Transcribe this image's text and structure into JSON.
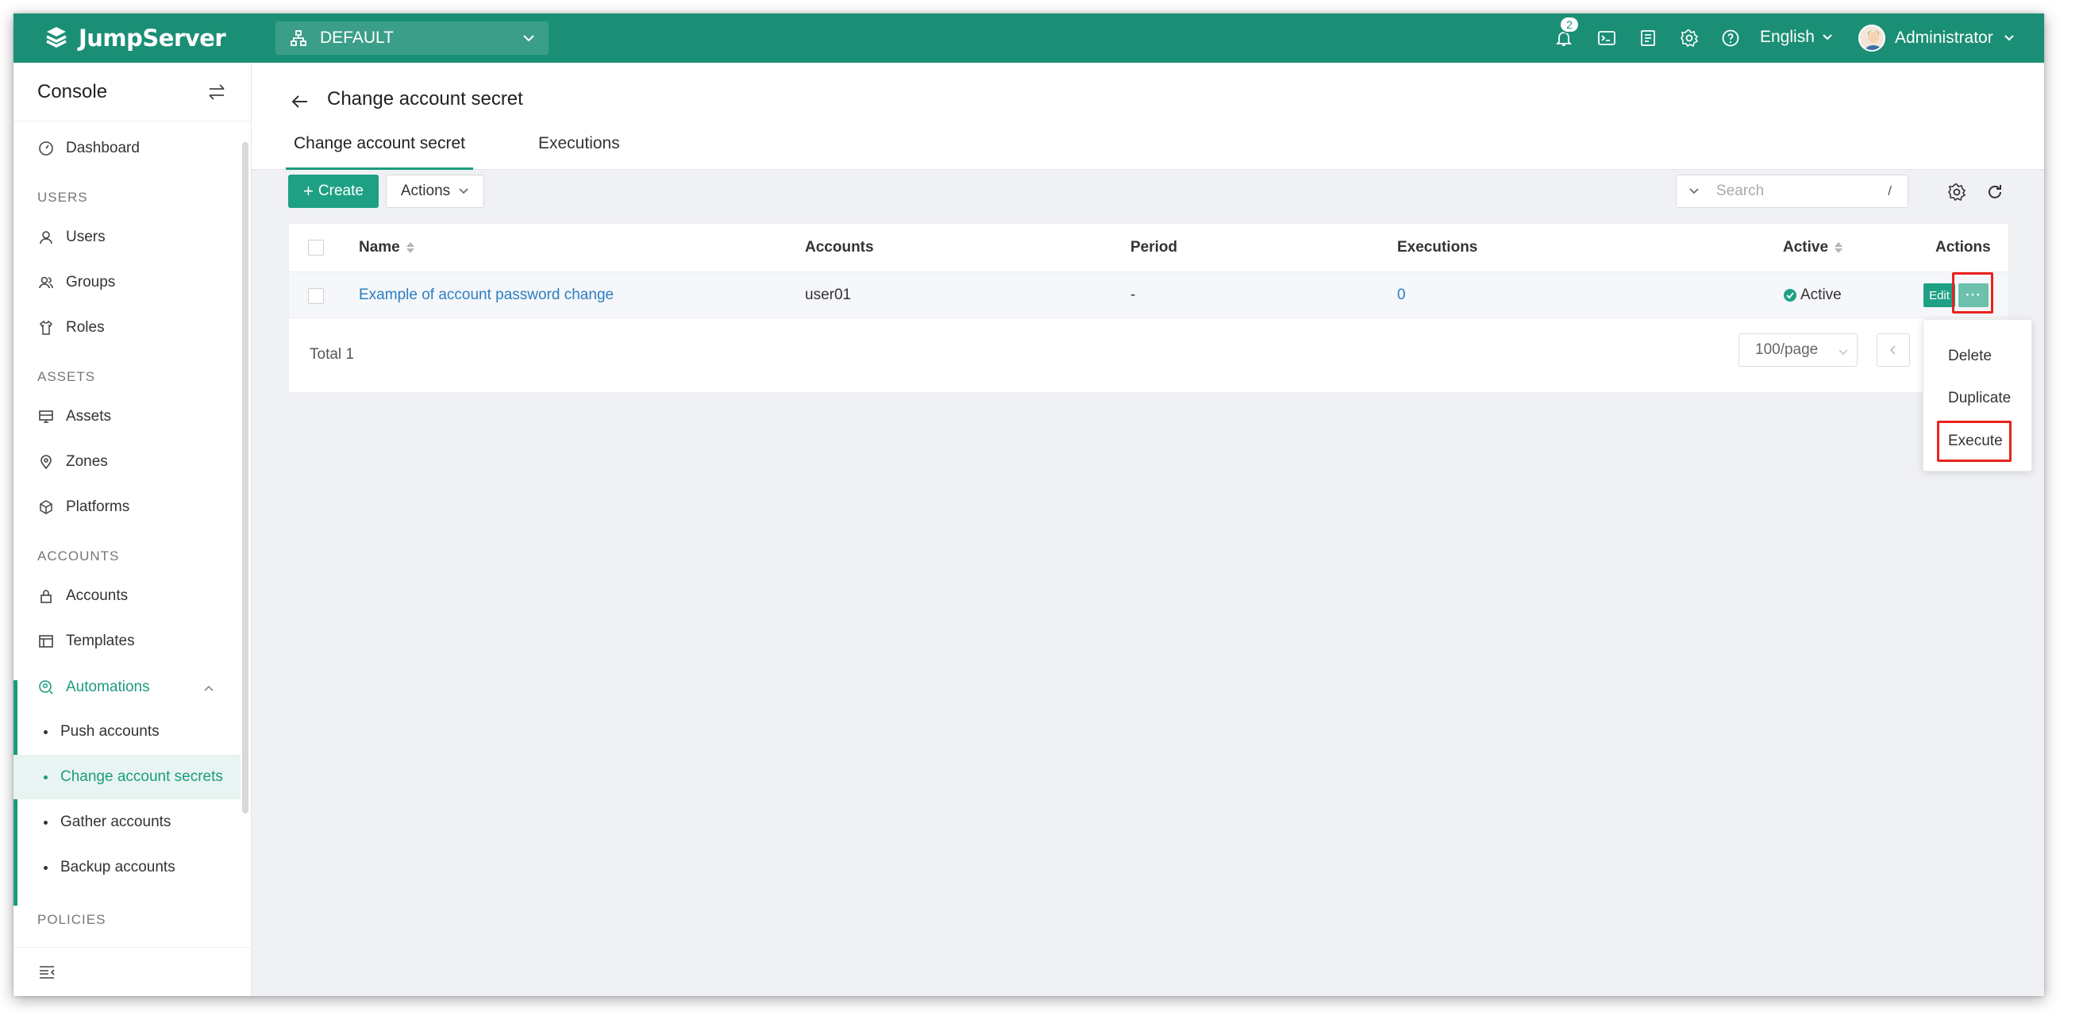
{
  "topbar": {
    "brand": "JumpServer",
    "org": "DEFAULT",
    "notifications": "2",
    "language": "English",
    "user": "Administrator"
  },
  "sidebar": {
    "title": "Console",
    "dashboard": "Dashboard",
    "groups": {
      "users": "USERS",
      "assets": "ASSETS",
      "accounts": "ACCOUNTS",
      "policies": "POLICIES"
    },
    "items": {
      "users": "Users",
      "groups": "Groups",
      "roles": "Roles",
      "assets": "Assets",
      "zones": "Zones",
      "platforms": "Platforms",
      "accounts": "Accounts",
      "templates": "Templates",
      "automations": "Automations"
    },
    "sub": {
      "push": "Push accounts",
      "change": "Change account secrets",
      "gather": "Gather accounts",
      "backup": "Backup accounts"
    }
  },
  "page": {
    "title": "Change account secret",
    "tabs": [
      "Change account secret",
      "Executions"
    ]
  },
  "toolbar": {
    "create": "Create",
    "actions": "Actions",
    "search_placeholder": "Search",
    "search_shortcut": "/"
  },
  "table": {
    "headers": {
      "name": "Name",
      "accounts": "Accounts",
      "period": "Period",
      "executions": "Executions",
      "active": "Active",
      "actions": "Actions"
    },
    "rows": [
      {
        "name": "Example of account password change",
        "accounts": "user01",
        "period": "-",
        "executions": "0",
        "active": "Active",
        "edit": "Edit",
        "more": "···"
      }
    ],
    "total": "Total 1",
    "page_size": "100/page"
  },
  "dropdown": {
    "items": [
      "Delete",
      "Duplicate",
      "Execute"
    ]
  },
  "colors": {
    "brand": "#1b8f75",
    "accent": "#1ea085",
    "link": "#2c7fc0",
    "highlight": "#e8231e"
  }
}
